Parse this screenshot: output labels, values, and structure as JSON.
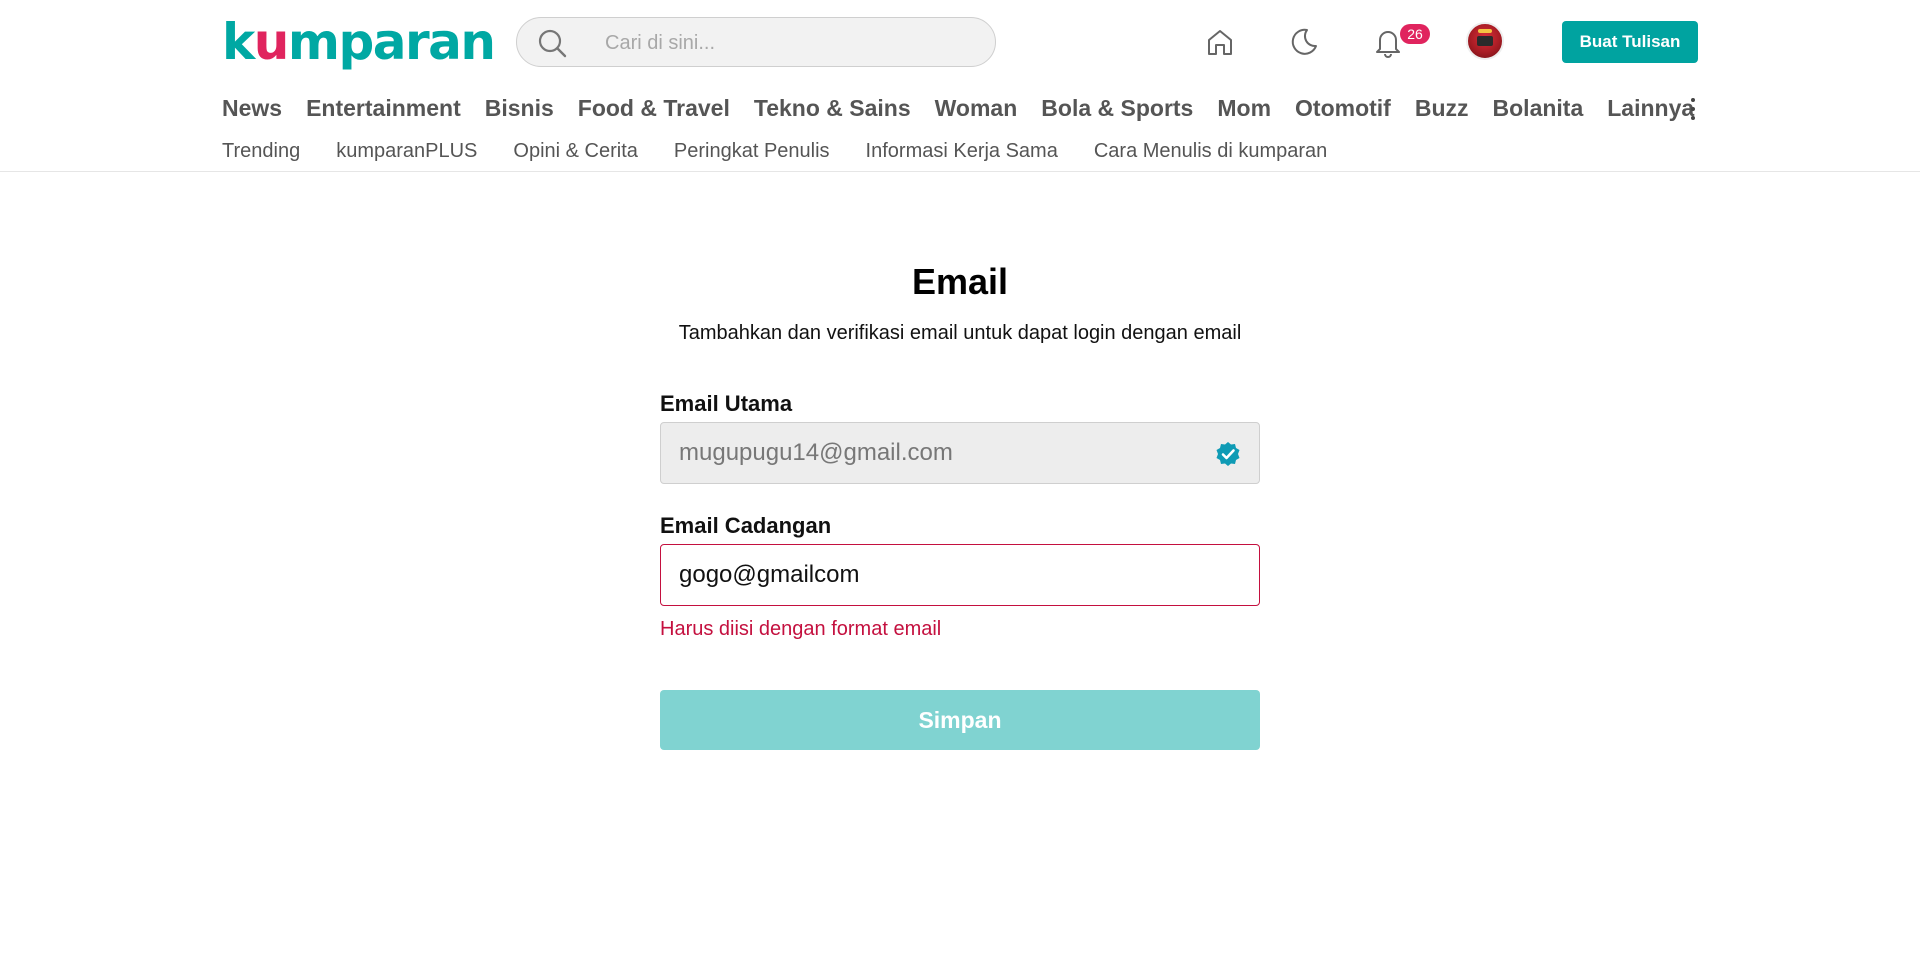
{
  "header": {
    "logo_text_pre": "k",
    "logo_text_u": "u",
    "logo_text_post": "mparan",
    "search_placeholder": "Cari di sini...",
    "notification_count": "26",
    "write_button_label": "Buat Tulisan",
    "brand_color": "#00a8a3",
    "accent_color": "#e0245e"
  },
  "nav": {
    "items": [
      "News",
      "Entertainment",
      "Bisnis",
      "Food & Travel",
      "Tekno & Sains",
      "Woman",
      "Bola & Sports",
      "Mom",
      "Otomotif",
      "Buzz",
      "Bolanita",
      "Lainnya"
    ]
  },
  "subnav": {
    "items": [
      "Trending",
      "kumparanPLUS",
      "Opini & Cerita",
      "Peringkat Penulis",
      "Informasi Kerja Sama",
      "Cara Menulis di kumparan"
    ]
  },
  "form": {
    "title": "Email",
    "subtitle": "Tambahkan dan verifikasi email untuk dapat login dengan email",
    "primary_label": "Email Utama",
    "primary_value": "mugupugu14@gmail.com",
    "backup_label": "Email Cadangan",
    "backup_value": "gogo@gmailcom",
    "error_message": "Harus diisi dengan format email",
    "save_label": "Simpan",
    "error_color": "#c4103f",
    "button_color": "#80d3d1"
  }
}
